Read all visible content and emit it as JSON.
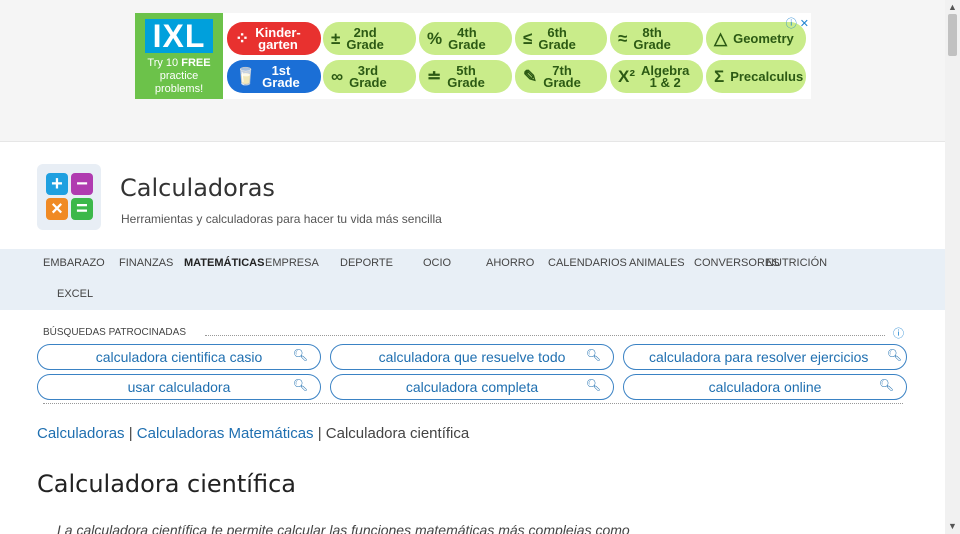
{
  "ad": {
    "brand": "IXL",
    "tagline_1": "Try 10",
    "tagline_free": "FREE",
    "tagline_2": "practice",
    "tagline_3": "problems!",
    "pills": [
      {
        "sym": "⁘",
        "label": "Kinder-\ngarten",
        "style": "red"
      },
      {
        "sym": "±",
        "label": "2nd\nGrade",
        "style": "green"
      },
      {
        "sym": "%",
        "label": "4th\nGrade",
        "style": "green"
      },
      {
        "sym": "≤",
        "label": "6th\nGrade",
        "style": "green"
      },
      {
        "sym": "≈",
        "label": "8th\nGrade",
        "style": "green"
      },
      {
        "sym": "△",
        "label": "Geometry",
        "style": "green"
      },
      {
        "sym": "🥛",
        "label": "1st\nGrade",
        "style": "blue"
      },
      {
        "sym": "∞",
        "label": "3rd\nGrade",
        "style": "green"
      },
      {
        "sym": "≐",
        "label": "5th\nGrade",
        "style": "green"
      },
      {
        "sym": "✎",
        "label": "7th\nGrade",
        "style": "green"
      },
      {
        "sym": "X²",
        "label": "Algebra\n1 & 2",
        "style": "green"
      },
      {
        "sym": "Σ",
        "label": "Precalculus",
        "style": "green"
      }
    ],
    "info_icon": "ⓘ",
    "close_icon": "✕"
  },
  "header": {
    "title": "Calculadoras",
    "subtitle": "Herramientas y calculadoras para hacer tu vida más sencilla"
  },
  "nav": {
    "items": [
      "EMBARAZO",
      "FINANZAS",
      "MATEMÁTICAS",
      "EMPRESA",
      "DEPORTE",
      "OCIO",
      "AHORRO",
      "CALENDARIOS",
      "ANIMALES",
      "CONVERSORES",
      "NUTRICIÓN",
      "EXCEL"
    ]
  },
  "sponsored": {
    "label": "BÚSQUEDAS PATROCINADAS",
    "searches": [
      "calculadora cientifica casio",
      "calculadora que resuelve todo",
      "calculadora para resolver ejercicios",
      "usar calculadora",
      "calculadora completa",
      "calculadora online"
    ]
  },
  "breadcrumb": {
    "home": "Calculadoras",
    "sep": "|",
    "section": "Calculadoras Matemáticas",
    "current": "Calculadora científica"
  },
  "page": {
    "title": "Calculadora científica",
    "intro": "La calculadora científica te permite calcular las funciones matemáticas más complejas como"
  },
  "colors": {
    "accent": "#1f6fb0",
    "nav_bg": "#e8eff6",
    "ad_green": "#c9ec8a",
    "ad_red": "#e8312f",
    "ad_blue": "#1b6fd6"
  }
}
